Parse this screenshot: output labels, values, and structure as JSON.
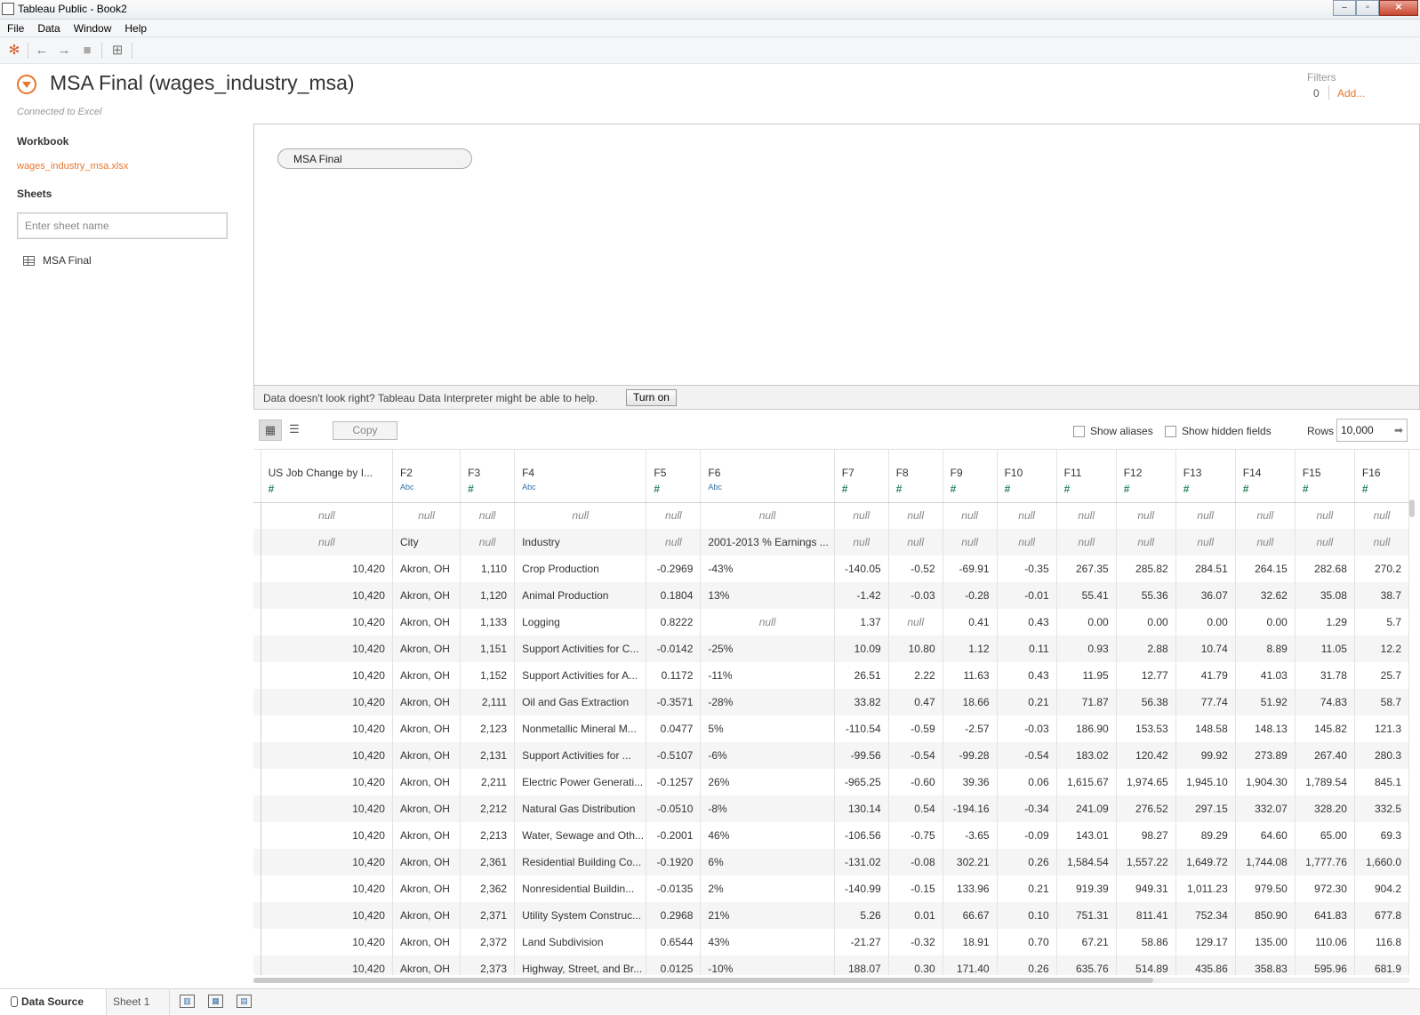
{
  "window": {
    "title": "Tableau Public - Book2",
    "minimize": "–",
    "maximize": "▫",
    "close": "✕"
  },
  "menu": [
    "File",
    "Data",
    "Window",
    "Help"
  ],
  "header": {
    "datasource_title": "MSA Final (wages_industry_msa)",
    "connection_status": "Connected to Excel",
    "filters_label": "Filters",
    "filters_count": "0",
    "filters_add": "Add..."
  },
  "left_pane": {
    "workbook_heading": "Workbook",
    "workbook_file": "wages_industry_msa.xlsx",
    "sheets_heading": "Sheets",
    "sheet_search_placeholder": "Enter sheet name",
    "sheets": [
      "MSA Final"
    ]
  },
  "canvas": {
    "table_pill": "MSA Final"
  },
  "interpreter": {
    "message": "Data doesn't look right? Tableau Data Interpreter might be able to help.",
    "button": "Turn on"
  },
  "grid_tools": {
    "copy": "Copy",
    "show_aliases": "Show aliases",
    "show_hidden_fields": "Show hidden fields",
    "rows_label": "Rows",
    "rows_value": "10,000"
  },
  "grid": {
    "columns": [
      {
        "name": "US Job Change by I...",
        "type": "#"
      },
      {
        "name": "F2",
        "type": "Abc"
      },
      {
        "name": "F3",
        "type": "#"
      },
      {
        "name": "F4",
        "type": "Abc"
      },
      {
        "name": "F5",
        "type": "#"
      },
      {
        "name": "F6",
        "type": "Abc"
      },
      {
        "name": "F7",
        "type": "#"
      },
      {
        "name": "F8",
        "type": "#"
      },
      {
        "name": "F9",
        "type": "#"
      },
      {
        "name": "F10",
        "type": "#"
      },
      {
        "name": "F11",
        "type": "#"
      },
      {
        "name": "F12",
        "type": "#"
      },
      {
        "name": "F13",
        "type": "#"
      },
      {
        "name": "F14",
        "type": "#"
      },
      {
        "name": "F15",
        "type": "#"
      },
      {
        "name": "F16",
        "type": "#"
      }
    ],
    "rows": [
      [
        "null",
        "null",
        "null",
        "null",
        "null",
        "null",
        "null",
        "null",
        "null",
        "null",
        "null",
        "null",
        "null",
        "null",
        "null",
        "null"
      ],
      [
        "null",
        "City",
        "null",
        "Industry",
        "null",
        "2001-2013 % Earnings ...",
        "null",
        "null",
        "null",
        "null",
        "null",
        "null",
        "null",
        "null",
        "null",
        "null"
      ],
      [
        "10,420",
        "Akron, OH",
        "1,110",
        "Crop Production",
        "-0.2969",
        "-43%",
        "-140.05",
        "-0.52",
        "-69.91",
        "-0.35",
        "267.35",
        "285.82",
        "284.51",
        "264.15",
        "282.68",
        "270.2"
      ],
      [
        "10,420",
        "Akron, OH",
        "1,120",
        "Animal Production",
        "0.1804",
        "13%",
        "-1.42",
        "-0.03",
        "-0.28",
        "-0.01",
        "55.41",
        "55.36",
        "36.07",
        "32.62",
        "35.08",
        "38.7"
      ],
      [
        "10,420",
        "Akron, OH",
        "1,133",
        "Logging",
        "0.8222",
        "null",
        "1.37",
        "null",
        "0.41",
        "0.43",
        "0.00",
        "0.00",
        "0.00",
        "0.00",
        "1.29",
        "5.7"
      ],
      [
        "10,420",
        "Akron, OH",
        "1,151",
        "Support Activities for C...",
        "-0.0142",
        "-25%",
        "10.09",
        "10.80",
        "1.12",
        "0.11",
        "0.93",
        "2.88",
        "10.74",
        "8.89",
        "11.05",
        "12.2"
      ],
      [
        "10,420",
        "Akron, OH",
        "1,152",
        "Support Activities for A...",
        "0.1172",
        "-11%",
        "26.51",
        "2.22",
        "11.63",
        "0.43",
        "11.95",
        "12.77",
        "41.79",
        "41.03",
        "31.78",
        "25.7"
      ],
      [
        "10,420",
        "Akron, OH",
        "2,111",
        "Oil and Gas Extraction",
        "-0.3571",
        "-28%",
        "33.82",
        "0.47",
        "18.66",
        "0.21",
        "71.87",
        "56.38",
        "77.74",
        "51.92",
        "74.83",
        "58.7"
      ],
      [
        "10,420",
        "Akron, OH",
        "2,123",
        "Nonmetallic Mineral M...",
        "0.0477",
        "5%",
        "-110.54",
        "-0.59",
        "-2.57",
        "-0.03",
        "186.90",
        "153.53",
        "148.58",
        "148.13",
        "145.82",
        "121.3"
      ],
      [
        "10,420",
        "Akron, OH",
        "2,131",
        "Support Activities for ...",
        "-0.5107",
        "-6%",
        "-99.56",
        "-0.54",
        "-99.28",
        "-0.54",
        "183.02",
        "120.42",
        "99.92",
        "273.89",
        "267.40",
        "280.3"
      ],
      [
        "10,420",
        "Akron, OH",
        "2,211",
        "Electric Power Generati...",
        "-0.1257",
        "26%",
        "-965.25",
        "-0.60",
        "39.36",
        "0.06",
        "1,615.67",
        "1,974.65",
        "1,945.10",
        "1,904.30",
        "1,789.54",
        "845.1"
      ],
      [
        "10,420",
        "Akron, OH",
        "2,212",
        "Natural Gas Distribution",
        "-0.0510",
        "-8%",
        "130.14",
        "0.54",
        "-194.16",
        "-0.34",
        "241.09",
        "276.52",
        "297.15",
        "332.07",
        "328.20",
        "332.5"
      ],
      [
        "10,420",
        "Akron, OH",
        "2,213",
        "Water, Sewage and Oth...",
        "-0.2001",
        "46%",
        "-106.56",
        "-0.75",
        "-3.65",
        "-0.09",
        "143.01",
        "98.27",
        "89.29",
        "64.60",
        "65.00",
        "69.3"
      ],
      [
        "10,420",
        "Akron, OH",
        "2,361",
        "Residential Building Co...",
        "-0.1920",
        "6%",
        "-131.02",
        "-0.08",
        "302.21",
        "0.26",
        "1,584.54",
        "1,557.22",
        "1,649.72",
        "1,744.08",
        "1,777.76",
        "1,660.0"
      ],
      [
        "10,420",
        "Akron, OH",
        "2,362",
        "Nonresidential Buildin...",
        "-0.0135",
        "2%",
        "-140.99",
        "-0.15",
        "133.96",
        "0.21",
        "919.39",
        "949.31",
        "1,011.23",
        "979.50",
        "972.30",
        "904.2"
      ],
      [
        "10,420",
        "Akron, OH",
        "2,371",
        "Utility System Construc...",
        "0.2968",
        "21%",
        "5.26",
        "0.01",
        "66.67",
        "0.10",
        "751.31",
        "811.41",
        "752.34",
        "850.90",
        "641.83",
        "677.8"
      ],
      [
        "10,420",
        "Akron, OH",
        "2,372",
        "Land Subdivision",
        "0.6544",
        "43%",
        "-21.27",
        "-0.32",
        "18.91",
        "0.70",
        "67.21",
        "58.86",
        "129.17",
        "135.00",
        "110.06",
        "116.8"
      ],
      [
        "10,420",
        "Akron, OH",
        "2,373",
        "Highway, Street, and Br...",
        "0.0125",
        "-10%",
        "188.07",
        "0.30",
        "171.40",
        "0.26",
        "635.76",
        "514.89",
        "435.86",
        "358.83",
        "595.96",
        "681.9"
      ]
    ]
  },
  "bottom_tabs": {
    "data_source": "Data Source",
    "sheet": "Sheet 1"
  }
}
